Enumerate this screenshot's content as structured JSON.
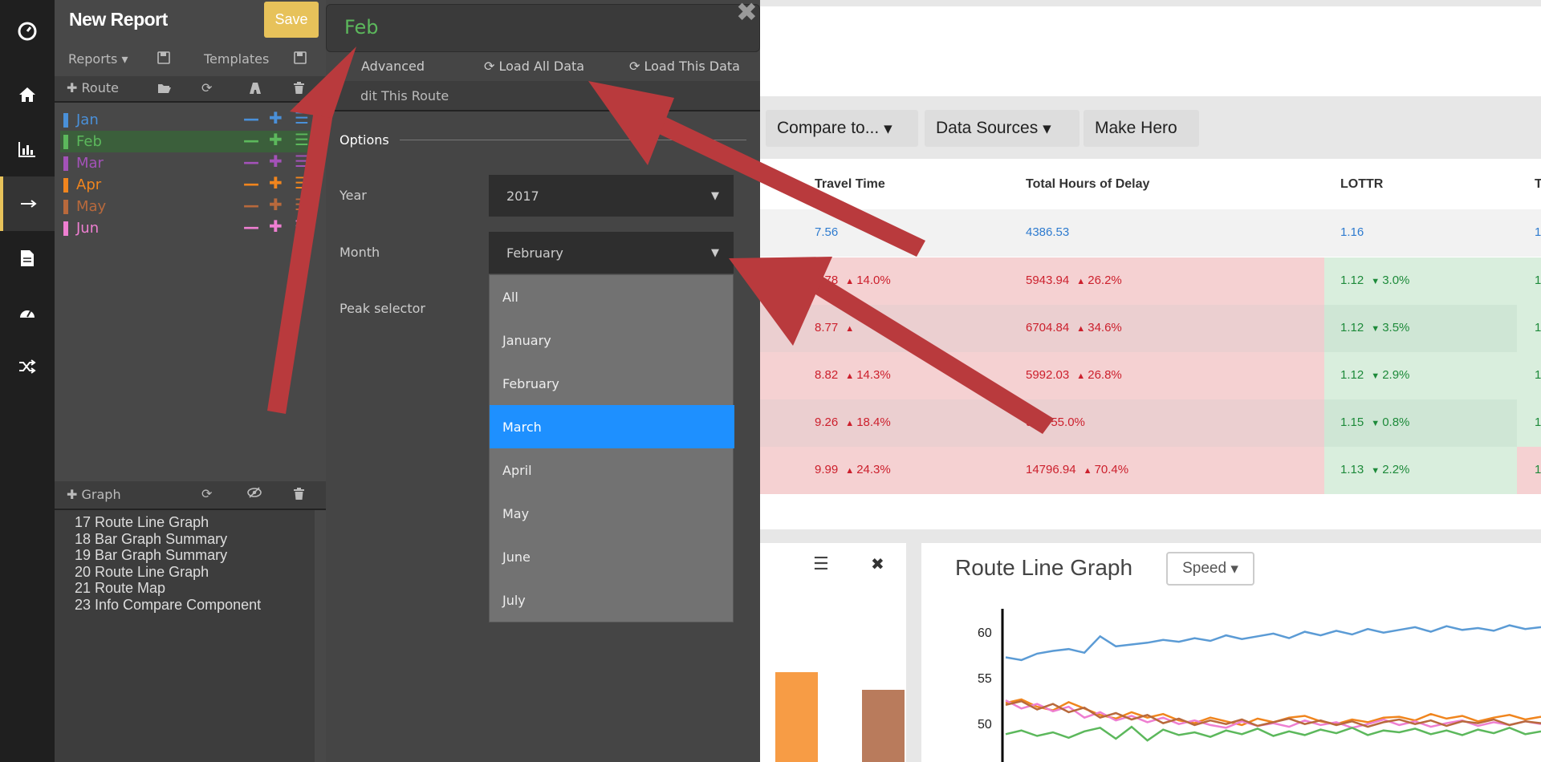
{
  "nav": {
    "icons": [
      "dashboard-icon",
      "home-icon",
      "bar-chart-icon",
      "arrow-right-icon",
      "document-icon",
      "gauge-icon",
      "shuffle-icon"
    ]
  },
  "sidebar": {
    "title": "New Report",
    "save": "Save",
    "reports": "Reports",
    "templates": "Templates",
    "route_add": "Route",
    "routes": [
      {
        "label": "Jan",
        "color": "#4a90d9"
      },
      {
        "label": "Feb",
        "color": "#5cb85c"
      },
      {
        "label": "Mar",
        "color": "#a352b8"
      },
      {
        "label": "Apr",
        "color": "#f0851e"
      },
      {
        "label": "May",
        "color": "#b8693c"
      },
      {
        "label": "Jun",
        "color": "#ee7fd1"
      }
    ],
    "graph_add": "Graph",
    "graphs": [
      "17 Route Line Graph",
      "18 Bar Graph Summary",
      "19 Bar Graph Summary",
      "20 Route Line Graph",
      "21 Route Map",
      "23 Info Compare Component"
    ]
  },
  "panel": {
    "route_name": "Feb",
    "advanced": "Advanced",
    "load_all": "Load All Data",
    "load_this": "Load This Data",
    "edit_route": "dit This Route",
    "options": "Options",
    "year_label": "Year",
    "year_value": "2017",
    "month_label": "Month",
    "month_value": "February",
    "peak_label": "Peak selector",
    "month_options": [
      "All",
      "January",
      "February",
      "March",
      "April",
      "May",
      "June",
      "July"
    ],
    "highlighted": "March"
  },
  "toolbar": {
    "compare": "Compare to...",
    "sources": "Data Sources",
    "hero": "Make Hero"
  },
  "table": {
    "headers": [
      "Travel Time",
      "Total Hours of Delay",
      "LOTTR",
      "T"
    ],
    "rows": [
      {
        "tt": "7.56",
        "delay": "4386.53",
        "lottr": "1.16",
        "last": "1."
      },
      {
        "tt": "8.78",
        "tt_ch": "14.0%",
        "delay": "5943.94",
        "delay_ch": "26.2%",
        "lottr": "1.12",
        "lottr_ch": "3.0%",
        "last": "1."
      },
      {
        "tt": "8.77",
        "tt_ch": "",
        "delay": "6704.84",
        "delay_ch": "34.6%",
        "lottr": "1.12",
        "lottr_ch": "3.5%",
        "last": "1."
      },
      {
        "tt": "8.82",
        "tt_ch": "14.3%",
        "delay": "5992.03",
        "delay_ch": "26.8%",
        "lottr": "1.12",
        "lottr_ch": "2.9%",
        "last": "1."
      },
      {
        "tt": "9.26",
        "tt_ch": "18.4%",
        "delay": "9",
        "delay_ch": "55.0%",
        "lottr": "1.15",
        "lottr_ch": "0.8%",
        "last": "1."
      },
      {
        "tt": "9.99",
        "tt_ch": "24.3%",
        "delay": "14796.94",
        "delay_ch": "70.4%",
        "lottr": "1.13",
        "lottr_ch": "2.2%",
        "last": "1."
      }
    ]
  },
  "graph": {
    "title": "Route Line Graph",
    "metric": "Speed",
    "yticks": [
      "60",
      "55",
      "50"
    ]
  },
  "chart_data": {
    "type": "line",
    "title": "Route Line Graph",
    "ylabel": "",
    "ylim": [
      48,
      62
    ],
    "series": [
      {
        "color": "#5b9bd5",
        "values": [
          57.5,
          57.2,
          57.9,
          58.2,
          58.4,
          58.0,
          59.8,
          58.7,
          58.9,
          59.1,
          59.4,
          59.2,
          59.6,
          59.3,
          59.9,
          59.5,
          59.8,
          60.1,
          59.6,
          60.3,
          59.9,
          60.4,
          60.0,
          60.6,
          60.2,
          60.5,
          60.8,
          60.3,
          60.9,
          60.5,
          60.7,
          60.4,
          61.0,
          60.6,
          60.8
        ]
      },
      {
        "color": "#f0851e",
        "values": [
          52.5,
          52.9,
          52.1,
          51.7,
          52.6,
          51.9,
          51.2,
          50.8,
          51.5,
          50.9,
          51.3,
          50.6,
          50.3,
          50.9,
          50.5,
          50.1,
          50.8,
          50.4,
          50.9,
          51.1,
          50.5,
          50.2,
          50.7,
          50.4,
          50.9,
          51.0,
          50.6,
          51.3,
          50.8,
          51.1,
          50.5,
          50.9,
          51.2,
          50.7,
          51.0
        ]
      },
      {
        "color": "#ee7fd1",
        "values": [
          52.8,
          51.9,
          52.4,
          51.6,
          52.1,
          50.9,
          51.5,
          50.6,
          51.1,
          50.4,
          50.9,
          50.2,
          50.6,
          50.1,
          49.8,
          50.5,
          50.0,
          50.3,
          49.9,
          50.6,
          50.1,
          50.4,
          49.8,
          50.2,
          50.7,
          50.1,
          50.5,
          49.9,
          50.3,
          50.6,
          50.0,
          50.4,
          50.1,
          50.5,
          50.2
        ]
      },
      {
        "color": "#b8693c",
        "values": [
          52.3,
          52.7,
          51.8,
          52.4,
          51.5,
          52.0,
          50.9,
          51.4,
          50.7,
          51.2,
          50.3,
          50.8,
          50.1,
          50.6,
          50.2,
          50.7,
          50.0,
          50.4,
          50.8,
          50.2,
          50.6,
          50.1,
          50.5,
          49.9,
          50.4,
          50.7,
          50.2,
          50.6,
          50.0,
          50.5,
          50.3,
          50.7,
          50.1,
          50.5,
          50.3
        ]
      },
      {
        "color": "#5cb85c",
        "values": [
          49.1,
          49.5,
          48.9,
          49.3,
          48.7,
          49.4,
          49.8,
          48.6,
          49.9,
          48.4,
          49.6,
          49.0,
          49.3,
          48.8,
          49.5,
          49.1,
          49.7,
          48.9,
          49.4,
          49.0,
          49.6,
          49.2,
          49.8,
          49.0,
          49.5,
          49.3,
          49.7,
          49.1,
          49.5,
          49.0,
          49.6,
          49.2,
          49.8,
          49.1,
          49.4
        ]
      }
    ]
  },
  "bars": {
    "values": [
      {
        "color": "#f79c45"
      },
      {
        "color": "#b97b5c"
      }
    ]
  }
}
